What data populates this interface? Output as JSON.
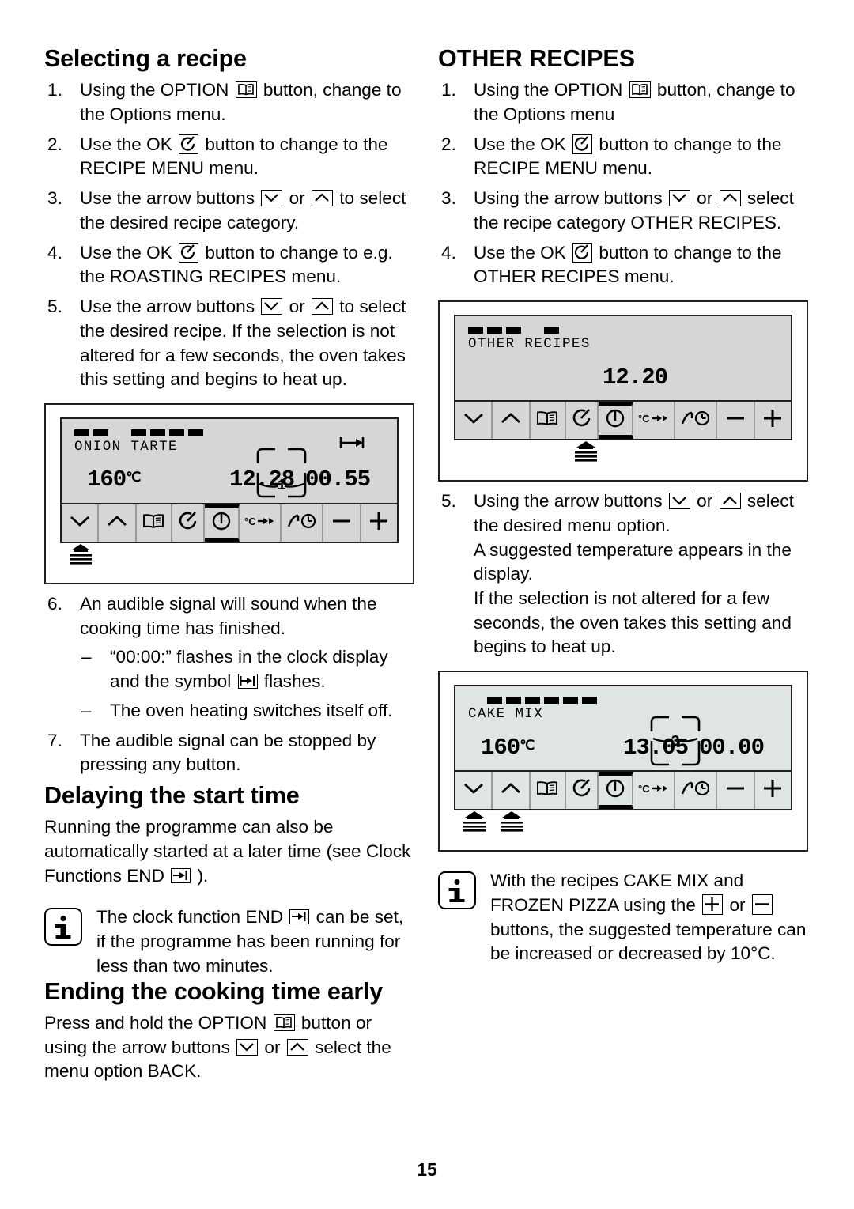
{
  "page": {
    "number": "15"
  },
  "left_column": {
    "section1": {
      "title": "Selecting a recipe",
      "steps": [
        {
          "num": "1.",
          "parts": [
            {
              "t": "Using the OPTION "
            },
            {
              "icon": "book-icon"
            },
            {
              "t": " button, change to the Options menu."
            }
          ]
        },
        {
          "num": "2.",
          "parts": [
            {
              "t": "Use the OK "
            },
            {
              "icon": "ok-icon"
            },
            {
              "t": " button to change to the RECIPE MENU menu."
            }
          ]
        },
        {
          "num": "3.",
          "parts": [
            {
              "t": "Use the arrow buttons "
            },
            {
              "icon": "arrow-down-icon"
            },
            {
              "t": " or "
            },
            {
              "icon": "arrow-up-icon"
            },
            {
              "t": " to select the desired recipe category."
            }
          ]
        },
        {
          "num": "4.",
          "parts": [
            {
              "t": "Use the OK "
            },
            {
              "icon": "ok-icon"
            },
            {
              "t": " button to change to e.g. the ROASTING RECIPES menu."
            }
          ]
        },
        {
          "num": "5.",
          "parts": [
            {
              "t": "Use the arrow buttons "
            },
            {
              "icon": "arrow-down-icon"
            },
            {
              "t": " or "
            },
            {
              "icon": "arrow-up-icon"
            },
            {
              "t": " to select the desired recipe. If the selection is not altered for a few seconds, the oven takes this setting and begins to heat up."
            }
          ]
        }
      ],
      "steps_after_figure": [
        {
          "num": "6.",
          "parts": [
            {
              "t": "An audible signal will sound when the cooking time has finished."
            }
          ],
          "sub": [
            {
              "dash": "–",
              "parts": [
                {
                  "t": "“00:00:” flashes in the clock display and the symbol "
                },
                {
                  "icon": "duration-icon"
                },
                {
                  "t": " flashes."
                }
              ]
            },
            {
              "dash": "–",
              "parts": [
                {
                  "t": "The oven heating switches itself off."
                }
              ]
            }
          ]
        },
        {
          "num": "7.",
          "parts": [
            {
              "t": "The audible signal can be stopped by pressing any button."
            }
          ]
        }
      ]
    },
    "section2": {
      "title": "Delaying the start time",
      "paragraph_parts": [
        {
          "t": "Running the programme can also be automatically started at a later time (see Clock Functions END "
        },
        {
          "icon": "end-icon"
        },
        {
          "t": " )."
        }
      ],
      "note_parts": [
        {
          "t": "The clock function END "
        },
        {
          "icon": "end-icon"
        },
        {
          "t": " can be set, if the programme has been running for less than two minutes."
        }
      ]
    },
    "section3": {
      "title": "Ending the cooking time early",
      "paragraph_parts": [
        {
          "t": "Press and hold the OPTION "
        },
        {
          "icon": "book-icon"
        },
        {
          "t": " button or using the arrow buttons "
        },
        {
          "icon": "arrow-down-icon"
        },
        {
          "t": " or "
        },
        {
          "icon": "arrow-up-icon"
        },
        {
          "t": " select the menu option BACK."
        }
      ]
    },
    "figure": {
      "name": "ONION TARTE",
      "temperature": "160",
      "temperature_unit": "℃",
      "clock": "12.28",
      "duration": "00.55",
      "rack_level": "1",
      "progress": [
        "on",
        "on",
        "off",
        "on",
        "on",
        "on",
        "on"
      ],
      "cursor_buttons": [
        "arrow-down"
      ],
      "buttons": [
        "arrow-down-icon",
        "arrow-up-icon",
        "book-icon",
        "ok-icon",
        "power-icon",
        "temp-fast-icon",
        "ramp-clock-icon",
        "minus-icon",
        "plus-icon"
      ]
    }
  },
  "right_column": {
    "section1": {
      "title": "OTHER RECIPES",
      "steps": [
        {
          "num": "1.",
          "parts": [
            {
              "t": "Using the OPTION "
            },
            {
              "icon": "book-icon"
            },
            {
              "t": " button, change to the Options menu"
            }
          ]
        },
        {
          "num": "2.",
          "parts": [
            {
              "t": "Use the OK "
            },
            {
              "icon": "ok-icon"
            },
            {
              "t": " button to change to the RECIPE MENU menu."
            }
          ]
        },
        {
          "num": "3.",
          "parts": [
            {
              "t": "Using the arrow buttons "
            },
            {
              "icon": "arrow-down-icon"
            },
            {
              "t": " or "
            },
            {
              "icon": "arrow-up-icon"
            },
            {
              "t": " select the recipe category OTHER RECIPES."
            }
          ]
        },
        {
          "num": "4.",
          "parts": [
            {
              "t": "Use the OK "
            },
            {
              "icon": "ok-icon"
            },
            {
              "t": " button to change to the OTHER RECIPES menu."
            }
          ]
        }
      ],
      "steps_after_figure": [
        {
          "num": "5.",
          "parts": [
            {
              "t": "Using the arrow buttons "
            },
            {
              "icon": "arrow-down-icon"
            },
            {
              "t": " or "
            },
            {
              "icon": "arrow-up-icon"
            },
            {
              "t": " select the desired menu option."
            },
            {
              "br": true
            },
            {
              "t": "A suggested temperature appears in the display."
            },
            {
              "br": true
            },
            {
              "t": "If the selection is not altered for a few seconds, the oven takes this setting and begins to heat up."
            }
          ]
        }
      ],
      "note_parts": [
        {
          "t": "With the recipes CAKE MIX and FROZEN PIZZA using the "
        },
        {
          "icon": "plus-icon"
        },
        {
          "t": " or "
        },
        {
          "icon": "minus-icon"
        },
        {
          "t": " buttons, the suggested temperature can be increased or decreased by 10°C."
        }
      ]
    },
    "figure1": {
      "name": "OTHER RECIPES",
      "temperature": "",
      "clock": "12.20",
      "duration": "",
      "rack_level": "",
      "progress": [
        "on",
        "on",
        "on",
        "off",
        "on"
      ],
      "cursor_buttons": [
        "ok"
      ],
      "buttons": [
        "arrow-down-icon",
        "arrow-up-icon",
        "book-icon",
        "ok-icon",
        "power-icon",
        "temp-fast-icon",
        "ramp-clock-icon",
        "minus-icon",
        "plus-icon"
      ]
    },
    "figure2": {
      "name": "CAKE MIX",
      "temperature": "160",
      "temperature_unit": "℃",
      "clock": "13.05",
      "duration": "00.00",
      "rack_level": "3",
      "progress": [
        "off",
        "on",
        "on",
        "on",
        "on",
        "on",
        "on"
      ],
      "cursor_buttons": [
        "arrow-down",
        "arrow-up"
      ],
      "buttons": [
        "arrow-down-icon",
        "arrow-up-icon",
        "book-icon",
        "ok-icon",
        "power-icon",
        "temp-fast-icon",
        "ramp-clock-icon",
        "minus-icon",
        "plus-icon"
      ]
    }
  }
}
